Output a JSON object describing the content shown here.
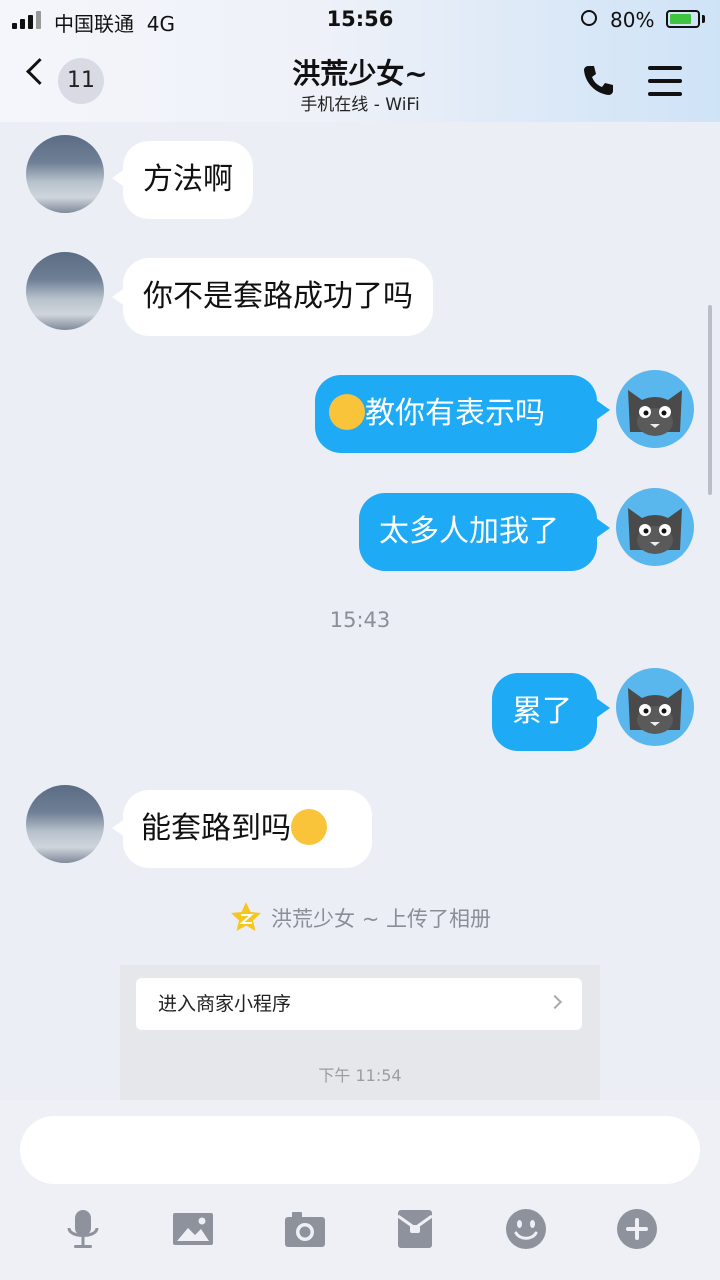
{
  "status": {
    "carrier": "中国联通",
    "network": "4G",
    "time": "15:56",
    "battery_percent": "80%",
    "battery_level": 0.8
  },
  "header": {
    "unread_count": "11",
    "title": "洪荒少女~",
    "subtitle": "手机在线 - WiFi"
  },
  "messages": [
    {
      "side": "left",
      "text": "方法啊"
    },
    {
      "side": "left",
      "text": "你不是套路成功了吗"
    },
    {
      "side": "right",
      "text": "教你有表示吗",
      "emoji": "spitting-emoji"
    },
    {
      "side": "right",
      "text": "太多人加我了"
    },
    {
      "side": "right",
      "text": "累了"
    },
    {
      "side": "left",
      "text": "能套路到吗",
      "emoji": "tears-of-joy-emoji"
    }
  ],
  "timestamp": "15:43",
  "notice": {
    "icon": "qzone-star-icon",
    "text": "洪荒少女 ~ 上传了相册"
  },
  "card": {
    "link_label": "进入商家小程序",
    "time": "下午 11:54"
  },
  "toolbar": {
    "icons": [
      "microphone-icon",
      "image-icon",
      "camera-icon",
      "red-packet-icon",
      "emoji-icon",
      "plus-icon"
    ]
  },
  "colors": {
    "bubble_right": "#1faaf5",
    "bubble_left": "#ffffff",
    "background": "#eceef6",
    "avatar_cat_bg": "#5ab7ee"
  }
}
